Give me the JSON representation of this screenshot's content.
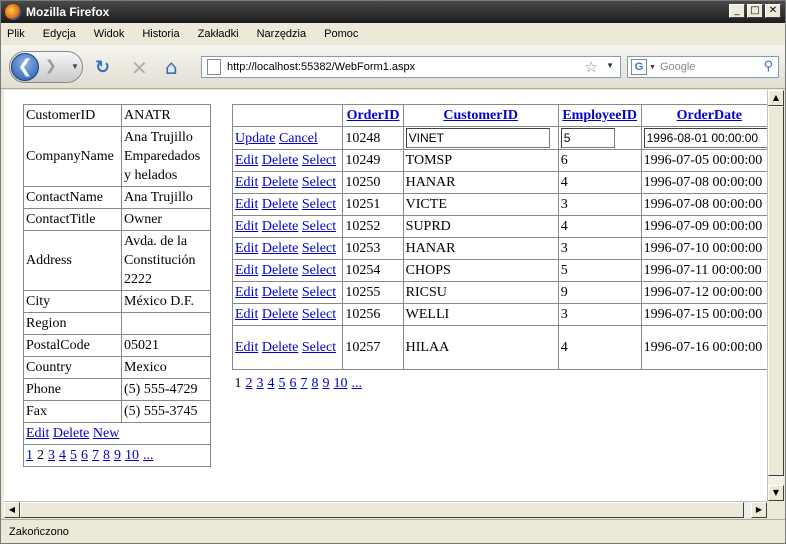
{
  "window": {
    "title": "Mozilla Firefox"
  },
  "menu": [
    "Plik",
    "Edycja",
    "Widok",
    "Historia",
    "Zakładki",
    "Narzędzia",
    "Pomoc"
  ],
  "nav": {
    "url": "http://localhost:55382/WebForm1.aspx",
    "search_placeholder": "Google"
  },
  "status": "Zakończono",
  "details": {
    "rows": [
      {
        "label": "CustomerID",
        "value": "ANATR"
      },
      {
        "label": "CompanyName",
        "value": "Ana Trujillo Emparedados y helados"
      },
      {
        "label": "ContactName",
        "value": "Ana Trujillo"
      },
      {
        "label": "ContactTitle",
        "value": "Owner"
      },
      {
        "label": "Address",
        "value": "Avda. de la Constitución 2222"
      },
      {
        "label": "City",
        "value": "México D.F."
      },
      {
        "label": "Region",
        "value": ""
      },
      {
        "label": "PostalCode",
        "value": "05021"
      },
      {
        "label": "Country",
        "value": "Mexico"
      },
      {
        "label": "Phone",
        "value": "(5) 555-4729"
      },
      {
        "label": "Fax",
        "value": "(5) 555-3745"
      }
    ],
    "commands": [
      "Edit",
      "Delete",
      "New"
    ],
    "pager": [
      "1",
      "2",
      "3",
      "4",
      "5",
      "6",
      "7",
      "8",
      "9",
      "10",
      "..."
    ],
    "current_page": "2"
  },
  "grid": {
    "headers": [
      "OrderID",
      "CustomerID",
      "EmployeeID",
      "OrderDate"
    ],
    "edit_row": {
      "update": "Update",
      "cancel": "Cancel",
      "order_id": "10248",
      "customer_id": "VINET",
      "employee_id": "5",
      "order_date": "1996-08-01 00:00:00"
    },
    "row_commands": [
      "Edit",
      "Delete",
      "Select"
    ],
    "rows": [
      {
        "order_id": "10249",
        "customer_id": "TOMSP",
        "employee_id": "6",
        "order_date": "1996-07-05 00:00:00"
      },
      {
        "order_id": "10250",
        "customer_id": "HANAR",
        "employee_id": "4",
        "order_date": "1996-07-08 00:00:00"
      },
      {
        "order_id": "10251",
        "customer_id": "VICTE",
        "employee_id": "3",
        "order_date": "1996-07-08 00:00:00"
      },
      {
        "order_id": "10252",
        "customer_id": "SUPRD",
        "employee_id": "4",
        "order_date": "1996-07-09 00:00:00"
      },
      {
        "order_id": "10253",
        "customer_id": "HANAR",
        "employee_id": "3",
        "order_date": "1996-07-10 00:00:00"
      },
      {
        "order_id": "10254",
        "customer_id": "CHOPS",
        "employee_id": "5",
        "order_date": "1996-07-11 00:00:00"
      },
      {
        "order_id": "10255",
        "customer_id": "RICSU",
        "employee_id": "9",
        "order_date": "1996-07-12 00:00:00"
      },
      {
        "order_id": "10256",
        "customer_id": "WELLI",
        "employee_id": "3",
        "order_date": "1996-07-15 00:00:00"
      },
      {
        "order_id": "10257",
        "customer_id": "HILAA",
        "employee_id": "4",
        "order_date": "1996-07-16 00:00:00"
      }
    ],
    "pager": [
      "1",
      "2",
      "3",
      "4",
      "5",
      "6",
      "7",
      "8",
      "9",
      "10",
      "..."
    ],
    "current_page": "1"
  }
}
